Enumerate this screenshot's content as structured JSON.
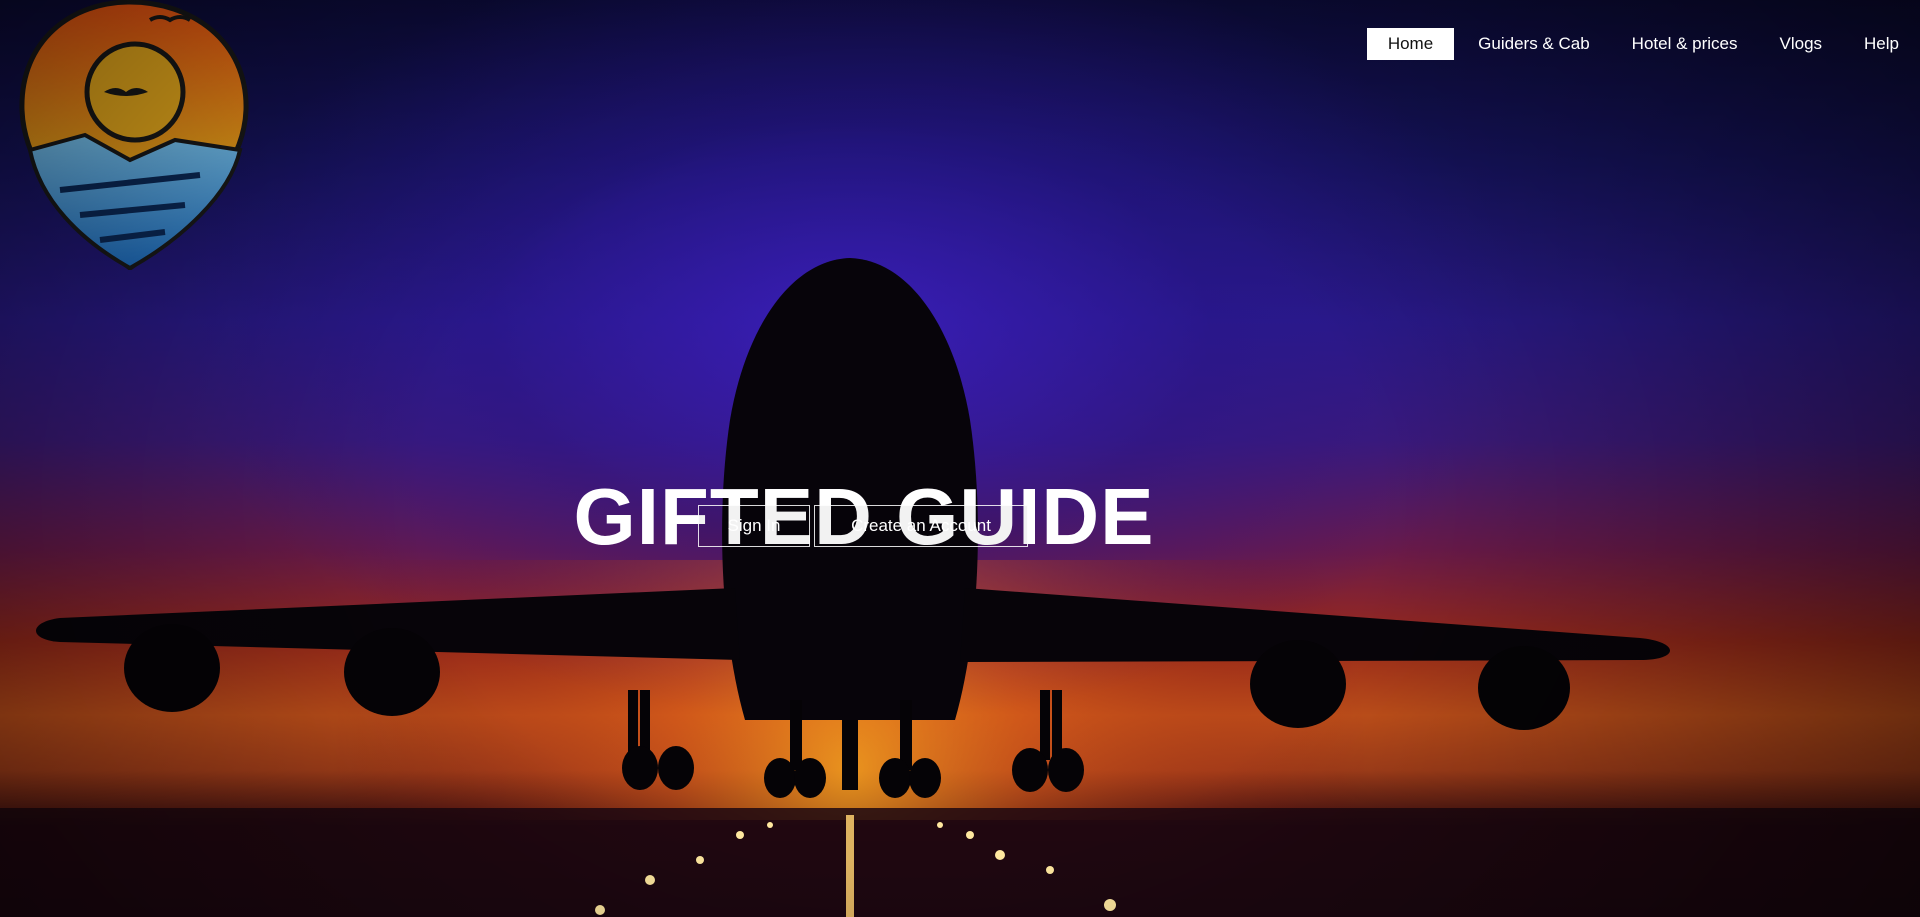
{
  "brand": {
    "title": "GIFTED GUIDE"
  },
  "nav": {
    "items": [
      {
        "label": "Home",
        "active": true
      },
      {
        "label": "Guiders & Cab",
        "active": false
      },
      {
        "label": "Hotel & prices",
        "active": false
      },
      {
        "label": "Vlogs",
        "active": false
      },
      {
        "label": "Help",
        "active": false
      }
    ]
  },
  "hero": {
    "sign_in_label": "Sign In",
    "create_account_label": "Create an Account",
    "background": "sunset-airplane-takeoff"
  },
  "logo": {
    "icon": "location-pin-sunset-logo",
    "colors": [
      "#f2a516",
      "#e8501c",
      "#3fa7e0"
    ]
  }
}
